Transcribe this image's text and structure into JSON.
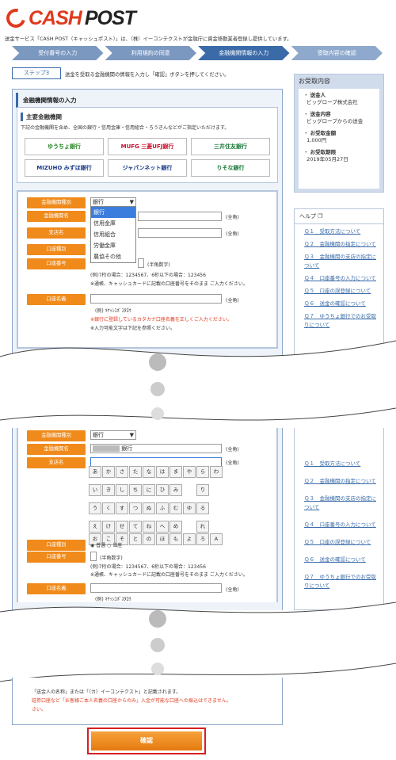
{
  "header": {
    "logo_text1": "CASH",
    "logo_text2": "POST",
    "intro": "送金サービス「CASH POST（キャッシュポスト）」は、（株）イーコンテクストが金融庁に資金移動業者登録し提供しています。"
  },
  "steps": [
    "受付番号の入力",
    "利用規約の同意",
    "金融機関情報の入力",
    "受取内容の確認"
  ],
  "step_badge": "ステップ3",
  "step_desc": "送金を受取る金融機関の情報を入力し「確認」ボタンを押してください。",
  "section_title": "金融機関情報の入力",
  "banks": {
    "title": "主要金融機関",
    "note": "下記の金融機関を含め、全国の銀行・信用金庫・信用組合・ろうきんなどがご指定いただけます。",
    "items": [
      "ゆうちょ銀行",
      "MUFG 三菱UFJ銀行",
      "三井住友銀行",
      "MIZUHO みずほ銀行",
      "ジャパンネット銀行",
      "りそな銀行"
    ]
  },
  "form": {
    "type_label": "金融機関種別",
    "type_value": "銀行",
    "type_options": [
      "銀行",
      "信用金庫",
      "信用組合",
      "労働金庫",
      "農協その他"
    ],
    "name_label": "金融機関名",
    "branch_label": "支店名",
    "acct_type_label": "口座種別",
    "acct_no_label": "口座番号",
    "holder_label": "口座名義",
    "zen": "(全角)",
    "han": "(半角数字)",
    "acct_no_note1": "(例)7桁の場合：1234567、6桁以下の場合：123456",
    "acct_no_note2": "※通帳、キャッシュカードに記載の口座番号をそのまま ご入力ください。",
    "holder_example": "(例) ｷﾔｯｼﾕﾎﾟｽﾀﾛｳ",
    "holder_warn": "※銀行に登録しているカタカナ口座名義を正しくご入力ください。",
    "holder_note": "※入力可能文字は下記を参照ください。",
    "bank_suffix": "銀行",
    "acct_type_opt1": "普通",
    "acct_type_opt2": "当座"
  },
  "kana": [
    [
      "あ",
      "か",
      "さ",
      "た",
      "な",
      "は",
      "ま",
      "や",
      "ら",
      "わ"
    ],
    [
      "い",
      "き",
      "し",
      "ち",
      "に",
      "ひ",
      "み",
      "",
      "り",
      ""
    ],
    [
      "う",
      "く",
      "す",
      "つ",
      "ぬ",
      "ふ",
      "む",
      "ゆ",
      "る",
      ""
    ],
    [
      "え",
      "け",
      "せ",
      "て",
      "ね",
      "へ",
      "め",
      "",
      "れ",
      ""
    ],
    [
      "お",
      "こ",
      "そ",
      "と",
      "の",
      "ほ",
      "も",
      "よ",
      "ろ",
      "A"
    ]
  ],
  "sidebar": {
    "recv_title": "お受取内容",
    "items": [
      {
        "label": "送金人",
        "value": "ビッグローブ株式会社"
      },
      {
        "label": "送金内容",
        "value": "ビッグローブからの送金"
      },
      {
        "label": "お受取金額",
        "value": "1,000円"
      },
      {
        "label": "お受取期限",
        "value": "2019年05月27日"
      }
    ],
    "help_title": "ヘルプ",
    "help_links": [
      "Ｑ１　受取方法について",
      "Ｑ２　金融機関の指定について",
      "Ｑ３　金融機関の支店の指定について",
      "Ｑ４　口座番号の入力について",
      "Ｑ５　口座の誤登録について",
      "Ｑ６　送金の確認について",
      "Ｑ７　ゆうちょ銀行でのお受取りについて"
    ]
  },
  "bottom": {
    "line1": "「送金人の名称」または「（カ）イーコンテクスト」と記載されます。",
    "line2": "証券口座など「お客様ご本人名義の口座からのみ」入金が可能な口座への振込はできません。",
    "line3": "さい。"
  },
  "confirm_label": "確認"
}
